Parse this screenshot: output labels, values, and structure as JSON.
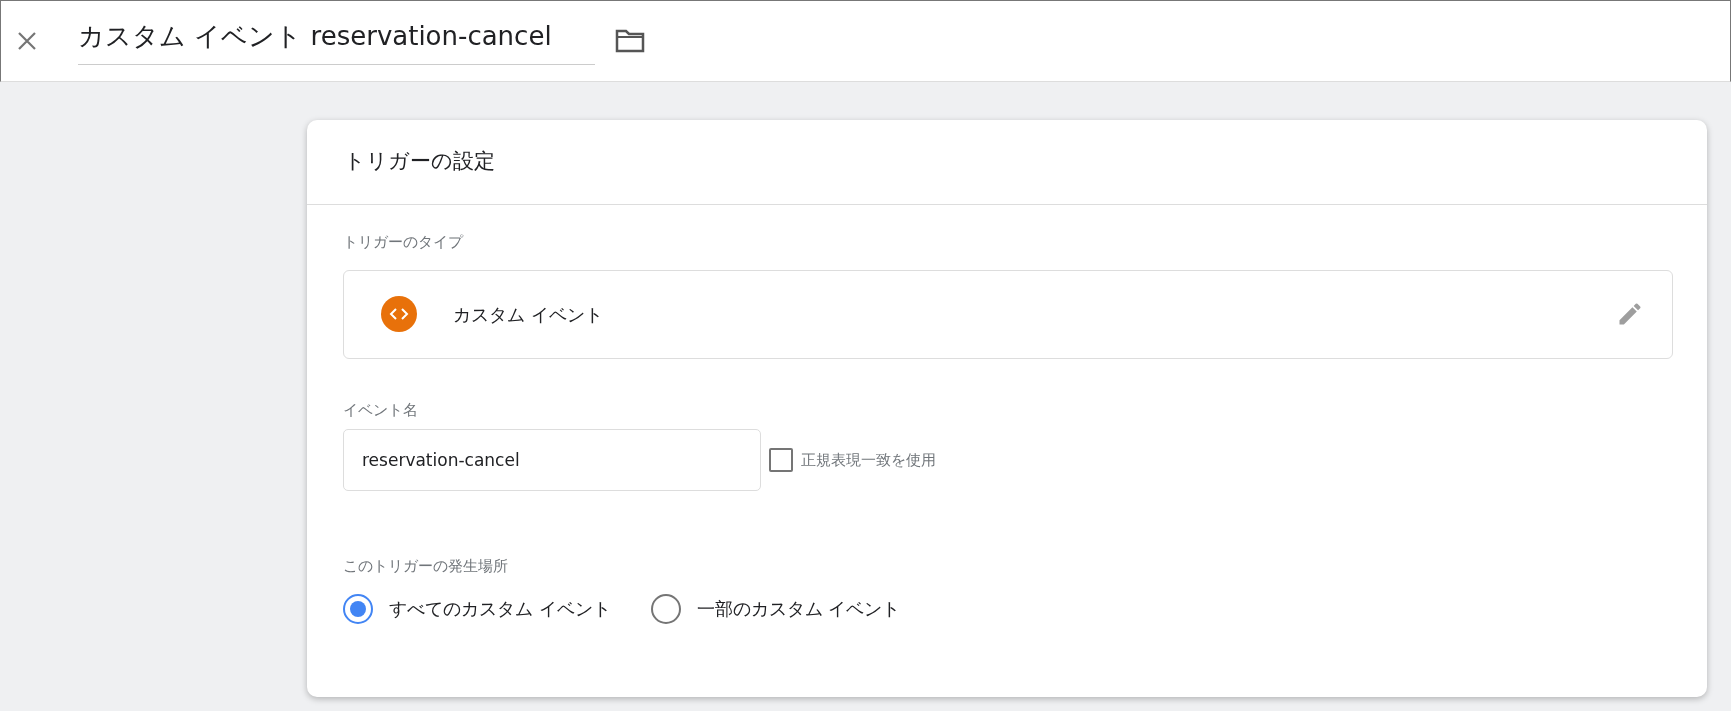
{
  "header": {
    "title": "カスタム イベント reservation-cancel"
  },
  "card": {
    "title": "トリガーの設定",
    "trigger_type": {
      "label": "トリガーのタイプ",
      "value": "カスタム イベント"
    },
    "event_name": {
      "label": "イベント名",
      "value": "reservation-cancel",
      "regex": {
        "label": "正規表現一致を使用",
        "checked": false
      }
    },
    "fires_on": {
      "label": "このトリガーの発生場所",
      "options": [
        {
          "label": "すべてのカスタム イベント",
          "selected": true
        },
        {
          "label": "一部のカスタム イベント",
          "selected": false
        }
      ]
    }
  }
}
